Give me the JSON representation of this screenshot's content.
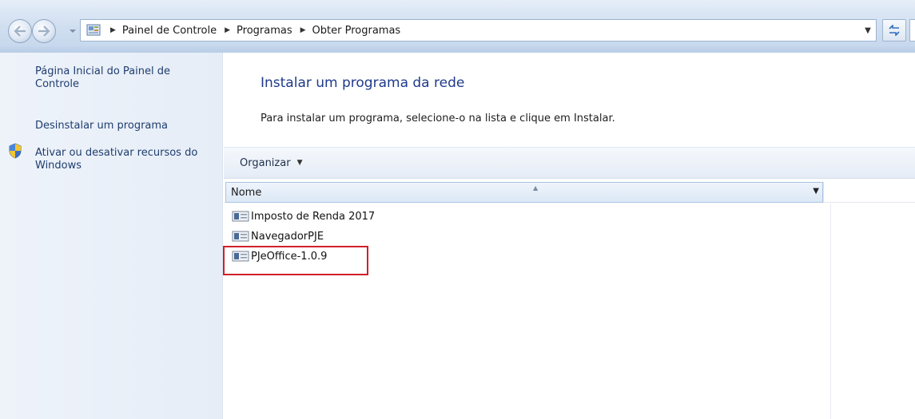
{
  "breadcrumb": [
    "Painel de Controle",
    "Programas",
    "Obter Programas"
  ],
  "sidebar": {
    "links": [
      "Página Inicial do Painel de Controle",
      "Desinstalar um programa",
      "Ativar ou desativar recursos do Windows"
    ]
  },
  "main": {
    "title": "Instalar um programa da rede",
    "instructions": "Para instalar um programa, selecione-o na lista e clique em Instalar.",
    "toolbar": {
      "organize_label": "Organizar"
    },
    "column_header": "Nome",
    "items": [
      "Imposto de Renda 2017",
      "NavegadorPJE",
      "PJeOffice-1.0.9"
    ]
  },
  "colors": {
    "link": "#1e3d6e",
    "title": "#1e3a8a",
    "highlight": "#d0202a"
  }
}
